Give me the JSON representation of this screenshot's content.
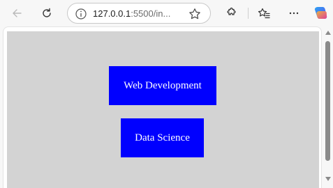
{
  "browser": {
    "url_host": "127.0.0.1",
    "url_rest": ":5500/in...",
    "icons": [
      "back-icon",
      "refresh-icon",
      "info-icon",
      "star-icon",
      "extensions-icon",
      "favorites-icon",
      "more-icon",
      "copilot-icon"
    ]
  },
  "page": {
    "background": "#d3d3d3",
    "cards": [
      {
        "label": "Web Development",
        "color": "#0000ff"
      },
      {
        "label": "Data Science",
        "color": "#0000ff"
      }
    ]
  }
}
